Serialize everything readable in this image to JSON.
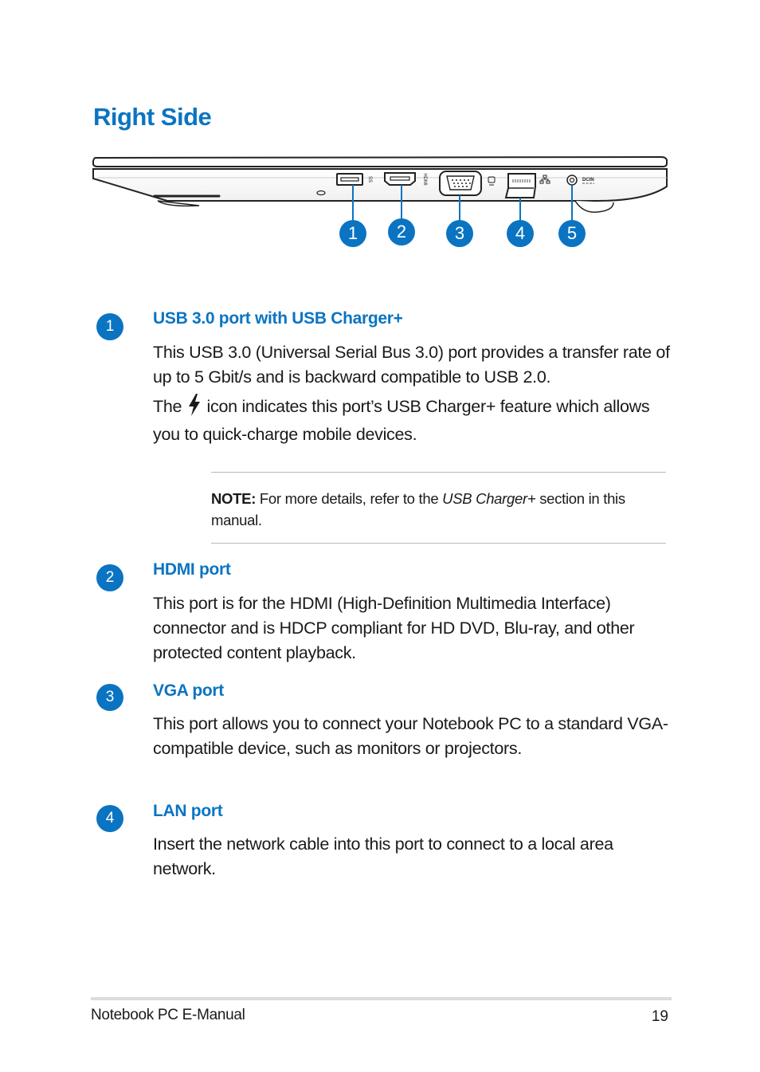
{
  "page": {
    "title": "Right Side",
    "accent_color": "#0a74c2"
  },
  "diagram": {
    "callouts": [
      "1",
      "2",
      "3",
      "4",
      "5"
    ],
    "port_labels": {
      "usb": "SS",
      "hdmi": "HDMI",
      "dcin": "DCIN"
    }
  },
  "sections": [
    {
      "number": "1",
      "heading": "USB 3.0 port with USB Charger+",
      "body_line1": "This USB 3.0 (Universal Serial Bus 3.0) port provides a transfer rate of up to 5 Gbit/s and is backward compatible to USB 2.0.",
      "body_pre_icon": "The",
      "body_post_icon": "icon indicates this port’s USB Charger+ feature which allows you to quick-charge mobile devices.",
      "icon": "lightning-bolt-icon"
    },
    {
      "number": "2",
      "heading": "HDMI port",
      "body": "This port is for the HDMI (High-Definition Multimedia Interface) connector and is HDCP compliant for HD DVD, Blu-ray, and other protected content playback."
    },
    {
      "number": "3",
      "heading": "VGA port",
      "body": "This port allows you to connect your Notebook PC to a standard VGA-compatible device, such as monitors or projectors."
    },
    {
      "number": "4",
      "heading": "LAN port",
      "body": "Insert the network cable into this port to connect to a local area network."
    }
  ],
  "note": {
    "label": "NOTE:",
    "text_before": " For more details, refer to the ",
    "italic": "USB Charger+",
    "text_after": " section in this manual."
  },
  "footer": {
    "title": "Notebook PC E-Manual",
    "page_number": "19"
  }
}
